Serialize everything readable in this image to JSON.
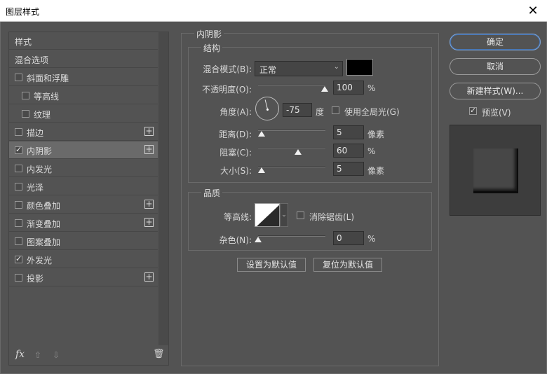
{
  "window": {
    "title": "图层样式",
    "close_glyph": "✕"
  },
  "left": {
    "items": [
      {
        "label": "样式",
        "checkbox": false,
        "checked": false,
        "indent": 0,
        "plus": false,
        "selected": false
      },
      {
        "label": "混合选项",
        "checkbox": false,
        "checked": false,
        "indent": 0,
        "plus": false,
        "selected": false
      },
      {
        "label": "斜面和浮雕",
        "checkbox": true,
        "checked": false,
        "indent": 0,
        "plus": false,
        "selected": false
      },
      {
        "label": "等高线",
        "checkbox": true,
        "checked": false,
        "indent": 1,
        "plus": false,
        "selected": false
      },
      {
        "label": "纹理",
        "checkbox": true,
        "checked": false,
        "indent": 1,
        "plus": false,
        "selected": false
      },
      {
        "label": "描边",
        "checkbox": true,
        "checked": false,
        "indent": 0,
        "plus": true,
        "selected": false
      },
      {
        "label": "内阴影",
        "checkbox": true,
        "checked": true,
        "indent": 0,
        "plus": true,
        "selected": true
      },
      {
        "label": "内发光",
        "checkbox": true,
        "checked": false,
        "indent": 0,
        "plus": false,
        "selected": false
      },
      {
        "label": "光泽",
        "checkbox": true,
        "checked": false,
        "indent": 0,
        "plus": false,
        "selected": false
      },
      {
        "label": "颜色叠加",
        "checkbox": true,
        "checked": false,
        "indent": 0,
        "plus": true,
        "selected": false
      },
      {
        "label": "渐变叠加",
        "checkbox": true,
        "checked": false,
        "indent": 0,
        "plus": true,
        "selected": false
      },
      {
        "label": "图案叠加",
        "checkbox": true,
        "checked": false,
        "indent": 0,
        "plus": false,
        "selected": false
      },
      {
        "label": "外发光",
        "checkbox": true,
        "checked": true,
        "indent": 0,
        "plus": false,
        "selected": false
      },
      {
        "label": "投影",
        "checkbox": true,
        "checked": false,
        "indent": 0,
        "plus": true,
        "selected": false
      }
    ],
    "plus_glyph": "+",
    "fx_label": "fx",
    "up_glyph": "⇧",
    "down_glyph": "⇩",
    "trash_glyph": "🗑"
  },
  "section": {
    "title": "内阴影",
    "structure": {
      "title": "结构",
      "blend_mode_label": "混合模式(B):",
      "blend_mode_value": "正常",
      "blend_color": "#000000",
      "opacity_label": "不透明度(O):",
      "opacity_value": "100",
      "opacity_unit": "%",
      "angle_label": "角度(A):",
      "angle_value": "-75",
      "angle_unit": "度",
      "global_light_label": "使用全局光(G)",
      "global_light_checked": false,
      "distance_label": "距离(D):",
      "distance_value": "5",
      "distance_unit": "像素",
      "choke_label": "阻塞(C):",
      "choke_value": "60",
      "choke_unit": "%",
      "size_label": "大小(S):",
      "size_value": "5",
      "size_unit": "像素"
    },
    "quality": {
      "title": "品质",
      "contour_label": "等高线:",
      "antialias_label": "消除锯齿(L)",
      "antialias_checked": false,
      "noise_label": "杂色(N):",
      "noise_value": "0",
      "noise_unit": "%"
    },
    "set_default_label": "设置为默认值",
    "reset_default_label": "复位为默认值"
  },
  "right": {
    "ok_label": "确定",
    "cancel_label": "取消",
    "new_style_label": "新建样式(W)...",
    "preview_label": "预览(V)",
    "preview_checked": true
  }
}
